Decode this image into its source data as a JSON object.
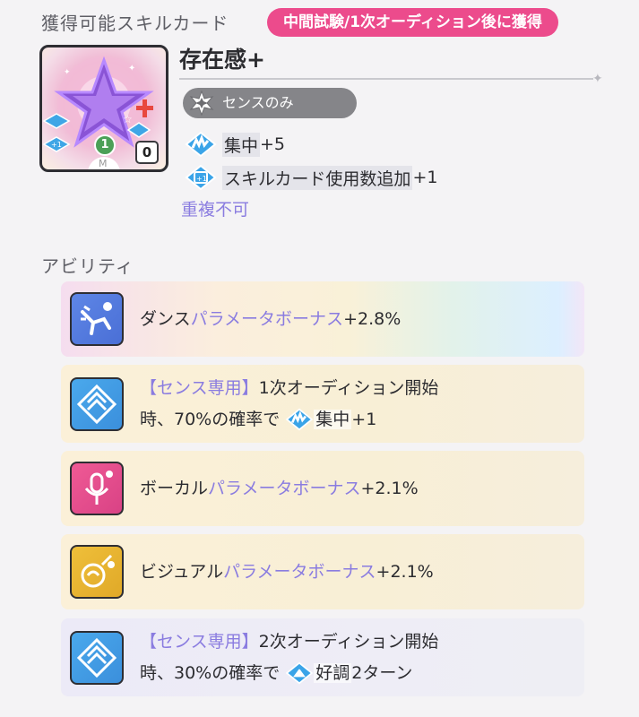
{
  "skill_section": {
    "title": "獲得可能スキルカード",
    "timing_badge": "中間試験/1次オーディション後に獲得"
  },
  "card": {
    "name": "存在感+",
    "cost": "0",
    "level": "1",
    "plan_badge": "センスのみ",
    "effects": [
      {
        "icon": "concentration-icon",
        "label": "集中",
        "value": "+5"
      },
      {
        "icon": "card-usage-plus-icon",
        "label": "スキルカード使用数追加",
        "value": "+1"
      }
    ],
    "note": "重複不可"
  },
  "ability_section": {
    "title": "アビリティ",
    "items": [
      {
        "icon": "dance-icon",
        "prefix": "ダンス",
        "highlight": "パラメータボーナス",
        "suffix": "+2.8%"
      },
      {
        "icon": "sense-plan-icon",
        "tag": "【センス専用】",
        "line1": "1次オーディション開始",
        "line2_pre": "時、70%の確率で",
        "buff_icon": "concentration-icon",
        "buff": "集中",
        "buff_value": "+1"
      },
      {
        "icon": "vocal-icon",
        "prefix": "ボーカル",
        "highlight": "パラメータボーナス",
        "suffix": "+2.1%"
      },
      {
        "icon": "visual-icon",
        "prefix": "ビジュアル",
        "highlight": "パラメータボーナス",
        "suffix": "+2.1%"
      },
      {
        "icon": "sense-plan-icon",
        "tag": "【センス専用】",
        "line1": "2次オーディション開始",
        "line2_pre": "時、30%の確率で",
        "buff_icon": "good-condition-icon",
        "buff": "好調",
        "buff_value": "2ターン"
      }
    ]
  },
  "colors": {
    "accent_pink": "#ec4b8c",
    "purple_text": "#8a7ce0",
    "plan_badge_gray": "#858589"
  }
}
